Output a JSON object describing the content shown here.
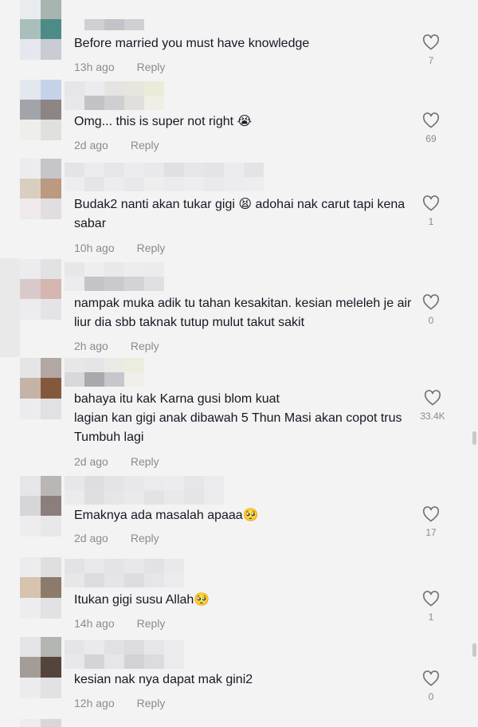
{
  "comments": [
    {
      "text": "Before married you must have knowledge",
      "time": "13h ago",
      "reply": "Reply",
      "likes": "7"
    },
    {
      "text": "Omg... this is super not right 😭",
      "time": "2d ago",
      "reply": "Reply",
      "likes": "69"
    },
    {
      "text": "Budak2 nanti akan tukar gigi 😫 adohai nak carut tapi kena sabar",
      "time": "10h ago",
      "reply": "Reply",
      "likes": "1"
    },
    {
      "text": "nampak muka adik tu tahan kesakitan. kesian meleleh je air liur dia sbb taknak tutup mulut takut sakit",
      "time": "2h ago",
      "reply": "Reply",
      "likes": "0"
    },
    {
      "text": "bahaya itu kak Karna gusi blom kuat\nlagian kan gigi anak dibawah 5 Thun Masi akan copot trus Tumbuh lagi",
      "time": "2d ago",
      "reply": "Reply",
      "likes": "33.4K"
    },
    {
      "text": "Emaknya ada masalah apaaa🥺",
      "time": "2d ago",
      "reply": "Reply",
      "likes": "17"
    },
    {
      "text": "Itukan gigi susu Allah🥺",
      "time": "14h ago",
      "reply": "Reply",
      "likes": "1"
    },
    {
      "text": "kesian nak nya dapat mak gini2",
      "time": "12h ago",
      "reply": "Reply",
      "likes": "0"
    }
  ],
  "icons": {
    "like": "heart-outline-icon"
  },
  "colors": {
    "background": "#f3f3f3",
    "text": "#161823",
    "meta": "#8a8b91"
  }
}
